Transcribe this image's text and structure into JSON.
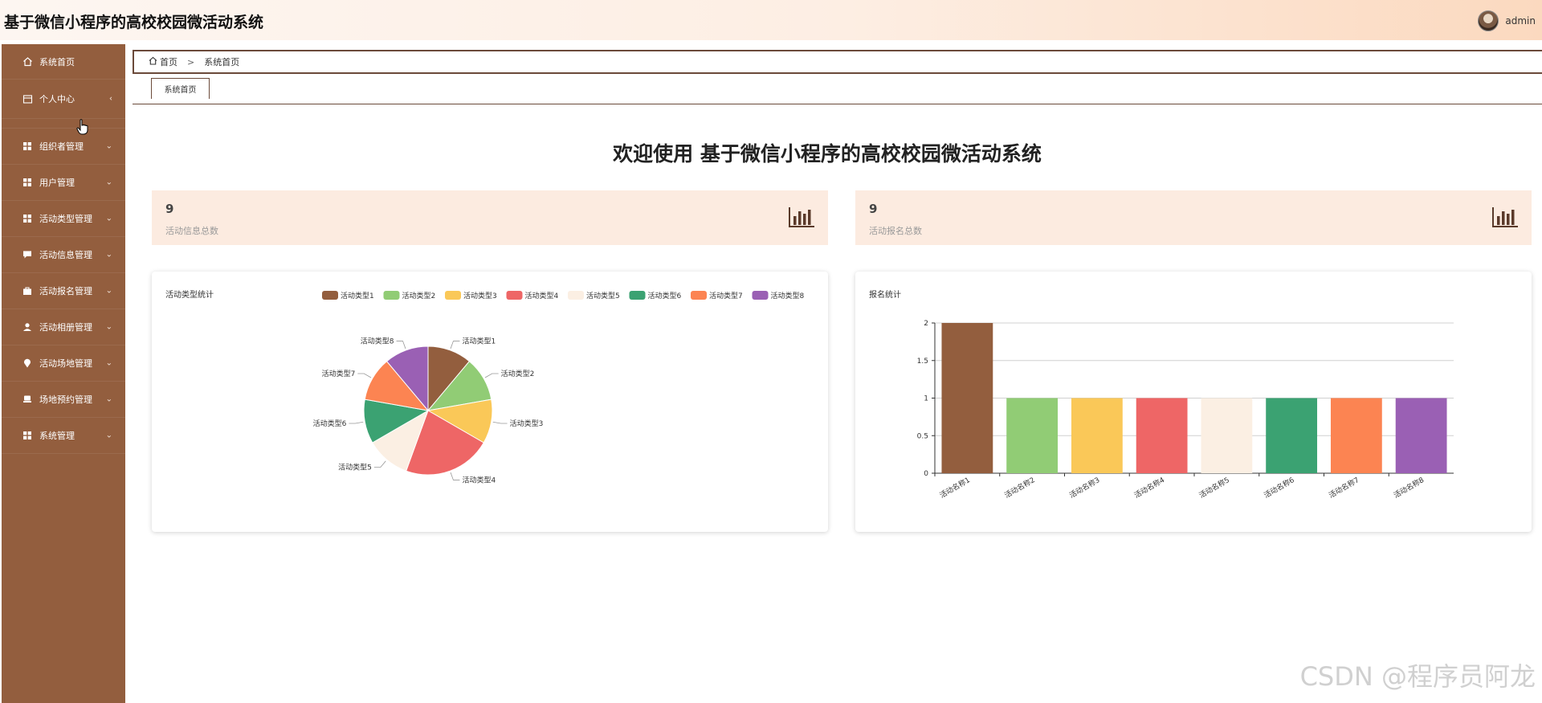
{
  "app": {
    "title": "基于微信小程序的高校校园微活动系统",
    "username": "admin"
  },
  "sidebar": {
    "items": [
      {
        "label": "系统首页",
        "icon": "home-icon",
        "chevron": ""
      },
      {
        "label": "个人中心",
        "icon": "profile-icon",
        "chevron": "‹"
      },
      {
        "label": "组织者管理",
        "icon": "grid-icon",
        "chevron": "⌄"
      },
      {
        "label": "用户管理",
        "icon": "grid-icon",
        "chevron": "⌄"
      },
      {
        "label": "活动类型管理",
        "icon": "grid-icon",
        "chevron": "⌄"
      },
      {
        "label": "活动信息管理",
        "icon": "chat-icon",
        "chevron": "⌄"
      },
      {
        "label": "活动报名管理",
        "icon": "bag-icon",
        "chevron": "⌄"
      },
      {
        "label": "活动相册管理",
        "icon": "user-icon",
        "chevron": "⌄"
      },
      {
        "label": "活动场地管理",
        "icon": "pin-icon",
        "chevron": "⌄"
      },
      {
        "label": "场地预约管理",
        "icon": "seat-icon",
        "chevron": "⌄"
      },
      {
        "label": "系统管理",
        "icon": "grid-icon",
        "chevron": "⌄"
      }
    ]
  },
  "breadcrumb": {
    "home": "首页",
    "separator": ">",
    "current": "系统首页"
  },
  "tabs": [
    {
      "label": "系统首页"
    }
  ],
  "welcome": "欢迎使用 基于微信小程序的高校校园微活动系统",
  "stats": [
    {
      "value": "9",
      "label": "活动信息总数"
    },
    {
      "value": "9",
      "label": "活动报名总数"
    }
  ],
  "colors": {
    "sidebar": "#935e3e",
    "stat_bg": "#fcebe0",
    "palette": [
      "#935e3e",
      "#91cc75",
      "#fac858",
      "#ee6666",
      "#fbefe3",
      "#3ba272",
      "#fc8452",
      "#9a60b4"
    ]
  },
  "watermark": "CSDN @程序员阿龙",
  "chart_data": [
    {
      "type": "pie",
      "title": "活动类型统计",
      "legend_position": "top-right",
      "categories": [
        "活动类型1",
        "活动类型2",
        "活动类型3",
        "活动类型4",
        "活动类型5",
        "活动类型6",
        "活动类型7",
        "活动类型8"
      ],
      "values": [
        1,
        1,
        1,
        2,
        1,
        1,
        1,
        1
      ]
    },
    {
      "type": "bar",
      "title": "报名统计",
      "categories": [
        "活动名称1",
        "活动名称2",
        "活动名称3",
        "活动名称4",
        "活动名称5",
        "活动名称6",
        "活动名称7",
        "活动名称8"
      ],
      "values": [
        2,
        1,
        1,
        1,
        1,
        1,
        1,
        1
      ],
      "ylim": [
        0,
        2
      ],
      "yticks": [
        "0",
        "0.5",
        "1",
        "1.5",
        "2"
      ],
      "grid": true
    }
  ]
}
